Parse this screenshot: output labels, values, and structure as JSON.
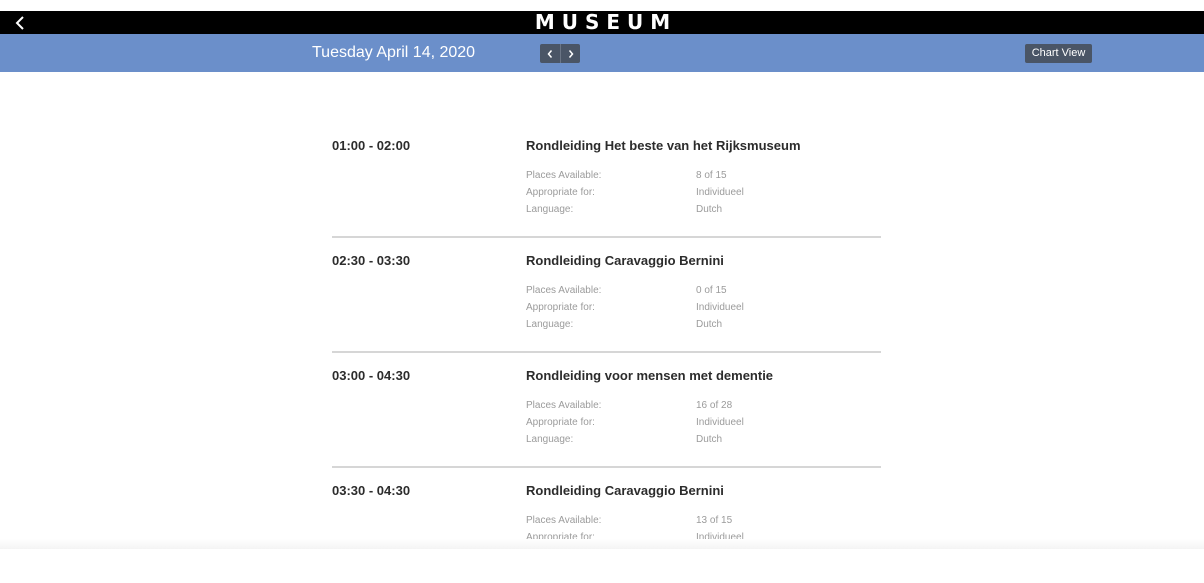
{
  "header": {
    "title": "MUSEUM",
    "back_icon": "chevron-left-icon"
  },
  "datebar": {
    "date": "Tuesday April 14, 2020",
    "prev_icon": "chevron-left-icon",
    "next_icon": "chevron-right-icon",
    "chart_view_label": "Chart View"
  },
  "labels": {
    "places": "Places Available:",
    "appropriate": "Appropriate for:",
    "language": "Language:"
  },
  "sessions": [
    {
      "time": "01:00 - 02:00",
      "title": "Rondleiding Het beste van het Rijksmuseum",
      "places": "8 of 15",
      "appropriate": "Individueel",
      "language": "Dutch"
    },
    {
      "time": "02:30 - 03:30",
      "title": "Rondleiding Caravaggio Bernini",
      "places": "0 of 15",
      "appropriate": "Individueel",
      "language": "Dutch"
    },
    {
      "time": "03:00 - 04:30",
      "title": "Rondleiding voor mensen met dementie",
      "places": "16 of 28",
      "appropriate": "Individueel",
      "language": "Dutch"
    },
    {
      "time": "03:30 - 04:30",
      "title": "Rondleiding Caravaggio Bernini",
      "places": "13 of 15",
      "appropriate": "Individueel"
    }
  ],
  "colors": {
    "topbar": "#000000",
    "datebar": "#6b8fca",
    "button": "#4a5566",
    "divider": "#d6d6d6"
  }
}
